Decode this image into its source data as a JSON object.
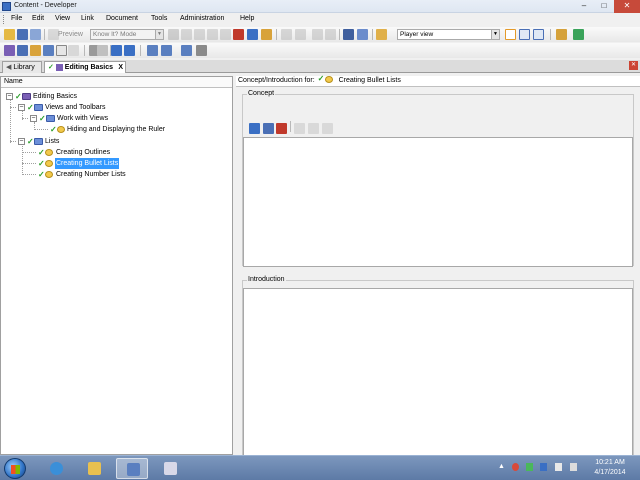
{
  "window": {
    "title": "Content - Developer",
    "min_glyph": "–",
    "max_glyph": "□",
    "close_glyph": "✕"
  },
  "menubar": {
    "items": [
      "File",
      "Edit",
      "View",
      "Link",
      "Document",
      "Tools",
      "Administration",
      "Help"
    ]
  },
  "toolbar1": {
    "preview_label": "Preview",
    "mode_select": "Know It? Mode",
    "view_select": "Player view"
  },
  "tabs": [
    {
      "label": "Library",
      "active": false
    },
    {
      "label": "Editing Basics",
      "active": true
    }
  ],
  "tab_close_glyph": "X",
  "strip_close_glyph": "✕",
  "tree": {
    "column_header": "Name",
    "nodes": [
      {
        "label": "Editing Basics",
        "type": "book",
        "level": 0,
        "expanded": true
      },
      {
        "label": "Views and Toolbars",
        "type": "book",
        "level": 1,
        "expanded": true
      },
      {
        "label": "Work with Views",
        "type": "book",
        "level": 2,
        "expanded": true
      },
      {
        "label": "Hiding and Displaying the Ruler",
        "type": "topic",
        "level": 3
      },
      {
        "label": "Lists",
        "type": "book",
        "level": 1,
        "expanded": true
      },
      {
        "label": "Creating Outlines",
        "type": "topic",
        "level": 2
      },
      {
        "label": "Creating Bullet Lists",
        "type": "topic",
        "level": 2,
        "selected": true
      },
      {
        "label": "Creating Number Lists",
        "type": "topic",
        "level": 2
      }
    ],
    "expander_glyph": "–",
    "check_glyph": "✓"
  },
  "right_pane": {
    "header_prefix": "Concept/Introduction for:",
    "header_topic": "Creating Bullet Lists",
    "concept_label": "Concept",
    "introduction_label": "Introduction"
  },
  "taskbar": {
    "time": "10:21 AM",
    "date": "4/17/2014"
  },
  "colors": {
    "selection": "#3399ff",
    "check": "#2a9d2a",
    "taskbar": "#5d7aa6"
  }
}
